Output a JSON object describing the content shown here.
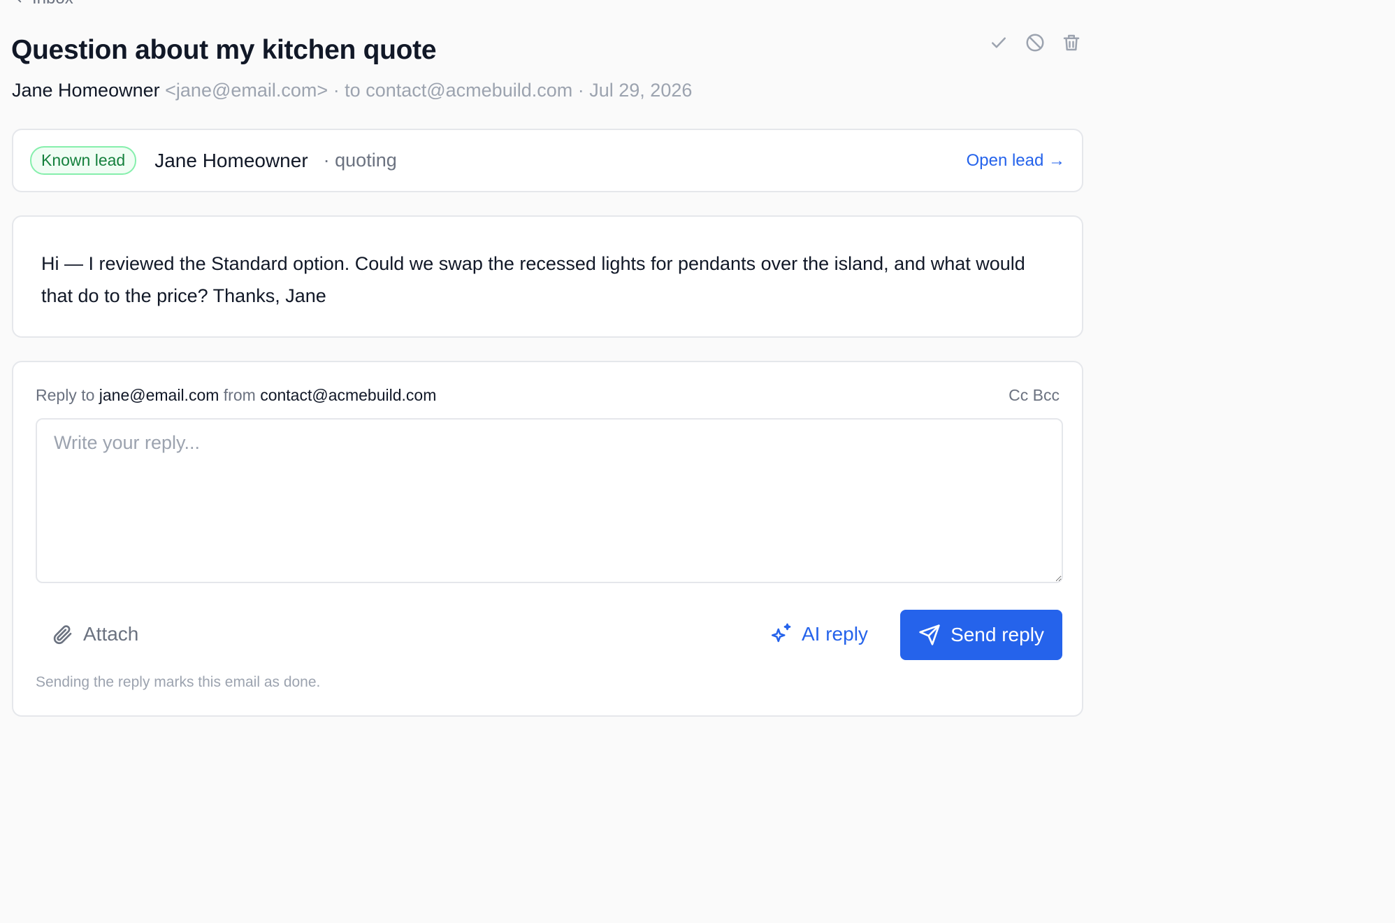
{
  "nav": {
    "back_label": "Inbox"
  },
  "email": {
    "subject": "Question about my kitchen quote",
    "from_name": "Jane Homeowner",
    "from_email": "<jane@email.com>",
    "to_text": "· to contact@acmebuild.com",
    "date_text": "· Jul 29, 2026",
    "body": "Hi — I reviewed the Standard option. Could we swap the recessed lights for pendants over the island, and what would that do to the price? Thanks, Jane"
  },
  "actions": {
    "icons": [
      "check-icon",
      "block-icon",
      "trash-icon"
    ]
  },
  "lead": {
    "badge": "Known lead",
    "name": "Jane Homeowner",
    "stage": "· quoting",
    "open_label": "Open lead →"
  },
  "reply": {
    "reply_to_label": "Reply to",
    "reply_to_value": "jane@email.com",
    "from_label": "from",
    "from_value": "contact@acmebuild.com",
    "cc_bcc_label": "Cc Bcc",
    "placeholder": "Write your reply...",
    "value": "",
    "attach_label": "Attach",
    "ai_reply_label": "AI reply",
    "send_label": "Send reply",
    "hint": "Sending the reply marks this email as done."
  },
  "colors": {
    "accent": "#2563eb",
    "badge_green": "#15803d",
    "muted": "#6b7280"
  }
}
